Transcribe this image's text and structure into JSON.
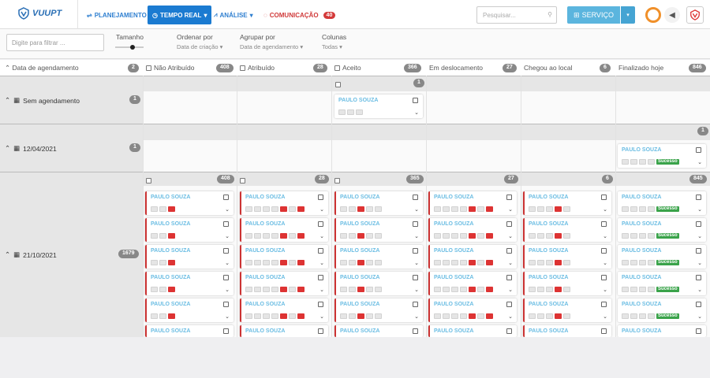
{
  "header": {
    "logo": "VUUPT",
    "nav": [
      "PLANEJAMENTO",
      "TEMPO REAL",
      "ANÁLISE",
      "COMUNICAÇÃO"
    ],
    "comm_badge": "40",
    "search_placeholder": "Pesquisar...",
    "service_label": "SERVIÇO"
  },
  "filters": {
    "filter_placeholder": "Digite para filtrar ...",
    "size_label": "Tamanho",
    "order_label": "Ordenar por",
    "order_value": "Data de criação",
    "group_label": "Agrupar por",
    "group_value": "Data de agendamento",
    "cols_label": "Colunas",
    "cols_value": "Todas"
  },
  "columns": [
    {
      "label": "Data de agendamento",
      "count": "2"
    },
    {
      "label": "Não Atribuído",
      "count": "408"
    },
    {
      "label": "Atribuído",
      "count": "28"
    },
    {
      "label": "Aceito",
      "count": "366"
    },
    {
      "label": "Em deslocamento",
      "count": "27"
    },
    {
      "label": "Chegou ao local",
      "count": "6"
    },
    {
      "label": "Finalizado hoje",
      "count": "846"
    }
  ],
  "rows": [
    {
      "label": "Sem agendamento",
      "count": "1",
      "col_counts": [
        "",
        "",
        "1",
        "",
        "",
        ""
      ]
    },
    {
      "label": "12/04/2021",
      "count": "1",
      "col_counts": [
        "",
        "",
        "",
        "",
        "",
        "1"
      ]
    },
    {
      "label": "21/10/2021",
      "count": "1679",
      "col_counts": [
        "408",
        "28",
        "365",
        "27",
        "6",
        "845"
      ]
    }
  ],
  "card_name": "PAULO SOUZA",
  "success_label": "Sucesso"
}
